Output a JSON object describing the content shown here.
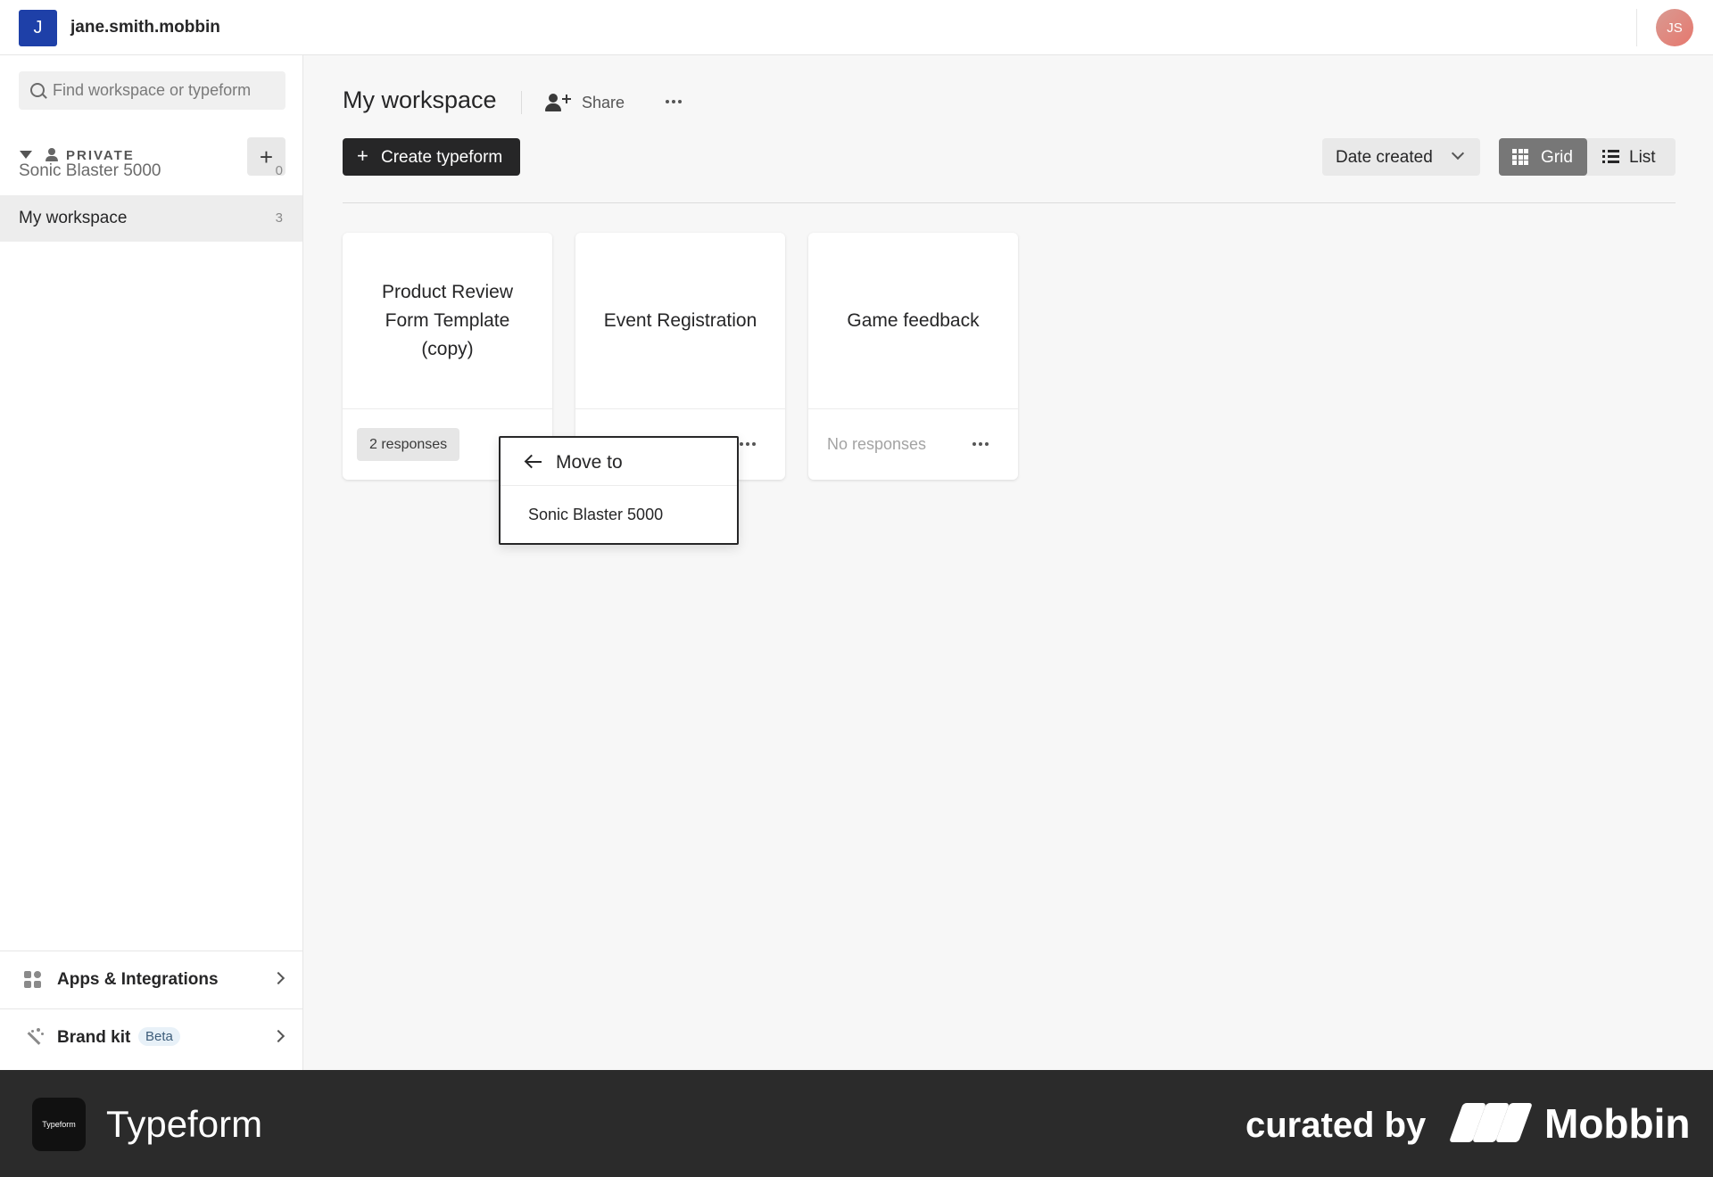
{
  "header": {
    "org_initial": "J",
    "org_name": "jane.smith.mobbin",
    "avatar_initials": "JS"
  },
  "sidebar": {
    "search_placeholder": "Find workspace or typeform",
    "section_label": "PRIVATE",
    "add_label": "+",
    "workspaces": [
      {
        "name": "Sonic Blaster 5000",
        "count": "0"
      },
      {
        "name": "My workspace",
        "count": "3"
      }
    ],
    "apps_label": "Apps & Integrations",
    "brand_kit_label": "Brand kit",
    "beta_label": "Beta"
  },
  "main": {
    "title": "My workspace",
    "share_label": "Share",
    "create_label": "Create typeform",
    "sort_label": "Date created",
    "view_grid_label": "Grid",
    "view_list_label": "List",
    "forms": [
      {
        "title": "Product Review Form Template (copy)",
        "responses": "2 responses"
      },
      {
        "title": "Event Registration",
        "responses": ""
      },
      {
        "title": "Game feedback",
        "responses": "No responses"
      }
    ]
  },
  "move_menu": {
    "header": "Move to",
    "options": [
      "Sonic Blaster 5000"
    ]
  },
  "footer": {
    "logo_text": "Typeform",
    "brand": "Typeform",
    "curated_by": "curated by",
    "mobbin": "Mobbin"
  },
  "colors": {
    "org_logo": "#1e40a8",
    "primary_button": "#262627",
    "grid_active": "#777777",
    "footer_bg": "#2b2b2b"
  }
}
